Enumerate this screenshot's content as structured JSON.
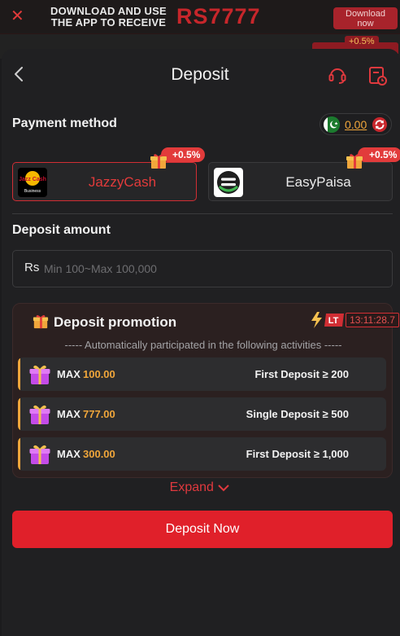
{
  "banner": {
    "close_icon": "close-icon",
    "text_line1": "DOWNLOAD AND USE",
    "text_line2": "THE APP TO RECEIVE",
    "amount": "RS7777",
    "download_line1": "Download",
    "download_line2": "now"
  },
  "background": {
    "bonus_badge": "+0.5%"
  },
  "header": {
    "title": "Deposit",
    "back_icon": "chevron-left-icon",
    "support_icon": "headset-icon",
    "history_icon": "history-icon"
  },
  "payment": {
    "section_title": "Payment method",
    "balance": "0.00",
    "flag_icon": "pakistan-flag-icon",
    "refresh_icon": "refresh-icon",
    "methods": [
      {
        "label": "JazzyCash",
        "bonus": "+0.5%",
        "selected": true,
        "logo_text_1": "Jazz Cash",
        "logo_text_2": "Business"
      },
      {
        "label": "EasyPaisa",
        "bonus": "+0.5%",
        "selected": false
      }
    ]
  },
  "amount": {
    "section_title": "Deposit amount",
    "currency_symbol": "Rs",
    "placeholder": "Min 100~Max 100,000"
  },
  "promotion": {
    "title": "Deposit promotion",
    "lt_badge": "LT",
    "timer": "13:11:28.7",
    "subtitle": "----- Automatically participated in the following activities -----",
    "rows": [
      {
        "max_label": "MAX",
        "value": "100.00",
        "condition": "First Deposit ≥ 200"
      },
      {
        "max_label": "MAX",
        "value": "777.00",
        "condition": "Single Deposit ≥ 500"
      },
      {
        "max_label": "MAX",
        "value": "300.00",
        "condition": "First Deposit ≥ 1,000"
      }
    ],
    "expand_label": "Expand"
  },
  "actions": {
    "deposit_now": "Deposit Now"
  },
  "colors": {
    "accent": "#e0202a",
    "gold": "#f0a63b",
    "sheet_bg": "#202022"
  }
}
